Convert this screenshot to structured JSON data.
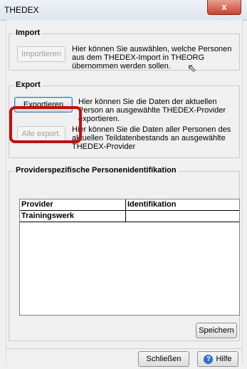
{
  "window": {
    "title": "THEDEX",
    "close_glyph": "x"
  },
  "import": {
    "label": "Import",
    "button": "Importieren",
    "description": "Hier können Sie auswählen, welche Personen aus dem THEDEX-Import in THEORG übernommen werden sollen."
  },
  "export": {
    "label": "Export",
    "button": "Exportieren",
    "description": "Hier können Sie die Daten der aktuellen Person an ausgewählte THEDEX-Provider exportieren.",
    "all_button": "Alle export.",
    "all_description": "Hier können Sie die Daten aller Personen des aktuellen Teildatenbestands an ausgewählte THEDEX-Provider"
  },
  "provider": {
    "label": "Providerspezifische Personenidentifikation",
    "columns": [
      "Provider",
      "Identifikation"
    ],
    "rows": [
      [
        "Trainingswerk",
        ""
      ]
    ],
    "save_button": "Speichern"
  },
  "footer": {
    "close_button": "Schließen",
    "help_button": "Hilfe"
  }
}
